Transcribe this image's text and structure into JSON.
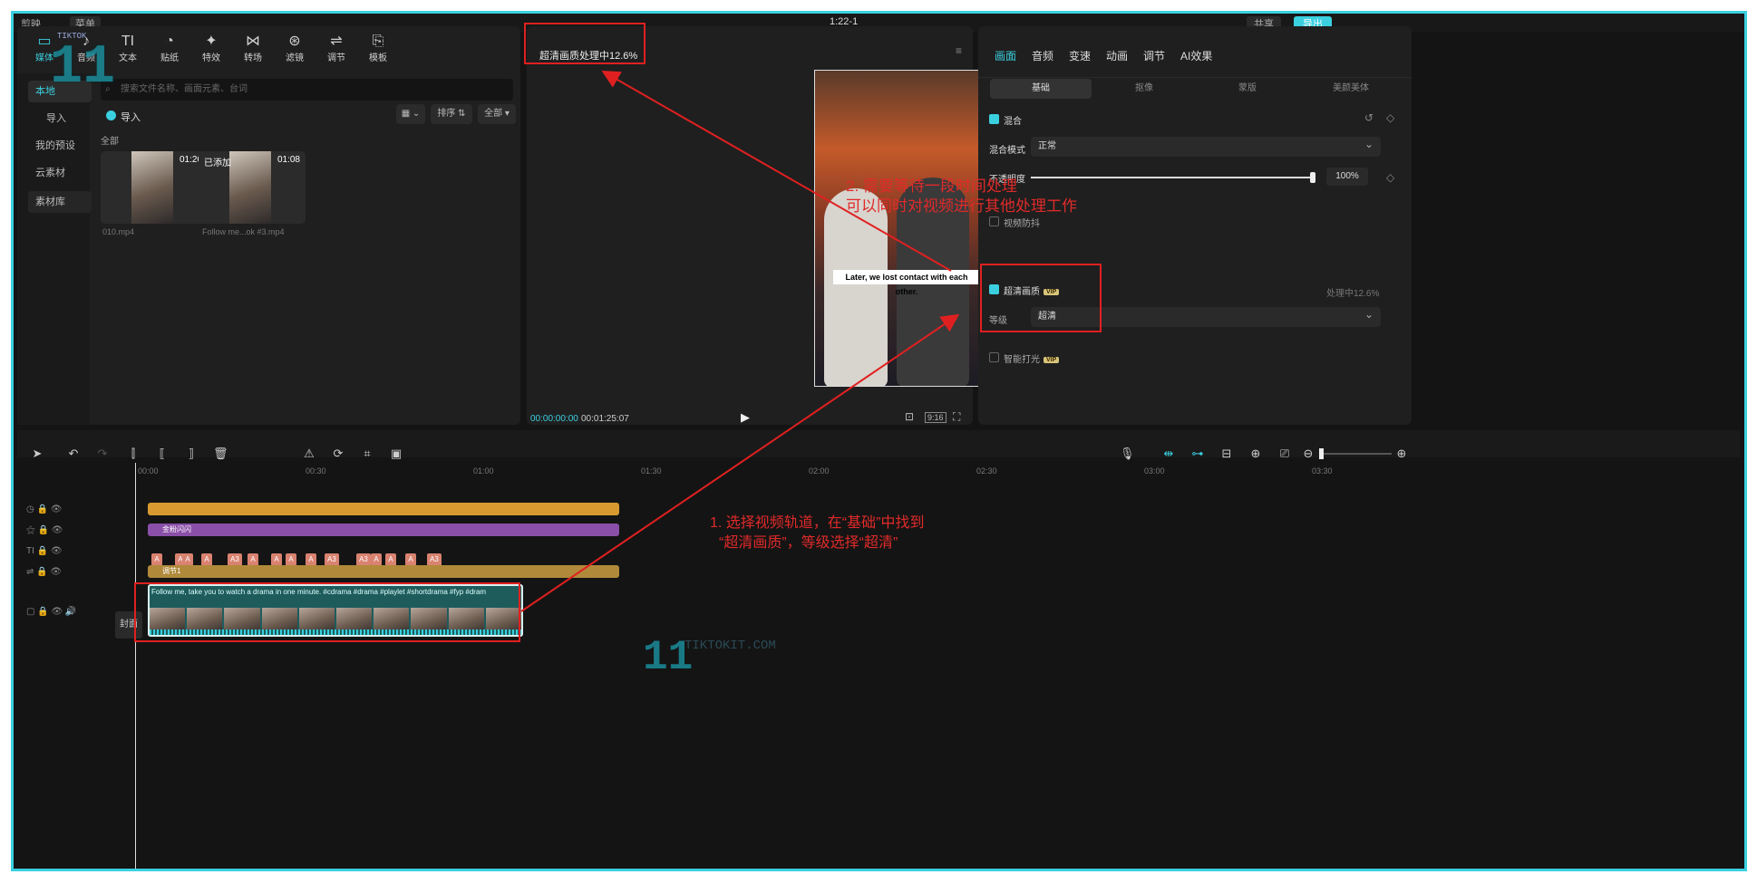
{
  "topbar": {
    "app_name": "剪映",
    "menu": "菜单",
    "project_time": "1:22-1",
    "share": "共享",
    "export": "导出"
  },
  "media_toolbar": [
    {
      "label": "媒体",
      "icon": "media-icon"
    },
    {
      "label": "音频",
      "icon": "audio-icon"
    },
    {
      "label": "文本",
      "icon": "text-icon"
    },
    {
      "label": "贴纸",
      "icon": "sticker-icon"
    },
    {
      "label": "特效",
      "icon": "effects-icon"
    },
    {
      "label": "转场",
      "icon": "transition-icon"
    },
    {
      "label": "滤镜",
      "icon": "filter-icon"
    },
    {
      "label": "调节",
      "icon": "adjust-icon"
    },
    {
      "label": "模板",
      "icon": "template-icon"
    }
  ],
  "media_sidebar": [
    "本地",
    "导入",
    "我的预设",
    "云素材",
    "素材库"
  ],
  "media_panel": {
    "search_placeholder": "搜索文件名称、画面元素、台词",
    "import_label": "导入",
    "sort_label": "排序",
    "all_label": "全部",
    "section_all": "全部",
    "files": [
      {
        "name": "010.mp4",
        "duration": "01:26",
        "tag": ""
      },
      {
        "name": "Follow me...ok #3.mp4",
        "duration": "01:08",
        "tag": "已添加"
      }
    ]
  },
  "player": {
    "status": "超清画质处理中12.6%",
    "subtitle": "Later, we lost contact with each other.",
    "current_time": "00:00:00:00",
    "total_time": "00:01:25:07",
    "ratio": "9:16"
  },
  "right_panel": {
    "tabs": [
      "画面",
      "音频",
      "变速",
      "动画",
      "调节",
      "AI效果"
    ],
    "subtabs": [
      "基础",
      "抠像",
      "蒙版",
      "美颜美体"
    ],
    "blend_label": "混合",
    "blend_mode_label": "混合模式",
    "blend_mode_value": "正常",
    "opacity_label": "不透明度",
    "opacity_value": "100%",
    "opacity_level": 1.0,
    "stabilize_label": "视频防抖",
    "hd_label": "超清画质",
    "vip": "VIP",
    "hd_status": "处理中12.6%",
    "level_label": "等级",
    "level_value": "超清",
    "smart_light_label": "智能打光"
  },
  "annotations": {
    "note2_line1": "2. 需要等待一段时间处理",
    "note2_line2": "可以同时对视频进行其他处理工作",
    "note1_line1": "1. 选择视频轨道，在“基础”中找到",
    "note1_line2": "“超清画质”，等级选择“超清”"
  },
  "timeline": {
    "ruler": [
      "00:00",
      "00:30",
      "01:00",
      "01:30",
      "02:00",
      "02:30",
      "03:00",
      "03:30"
    ],
    "effect_track_label": "金粉闪闪",
    "adjust_track_label": "调节1",
    "video_caption": "Follow me, take you to watch a drama in one minute. #cdrama #drama #playlet #shortdrama #fyp #dram",
    "cover_label": "封面",
    "text_clips": [
      "A",
      "A",
      "A",
      "A",
      "A3",
      "A",
      "A",
      "A",
      "A",
      "A3",
      "A3",
      "A",
      "A",
      "A",
      "A3"
    ]
  },
  "watermark": {
    "number": "11",
    "brand": "TIKTOKIT.COM",
    "small": "TIKTOK"
  }
}
